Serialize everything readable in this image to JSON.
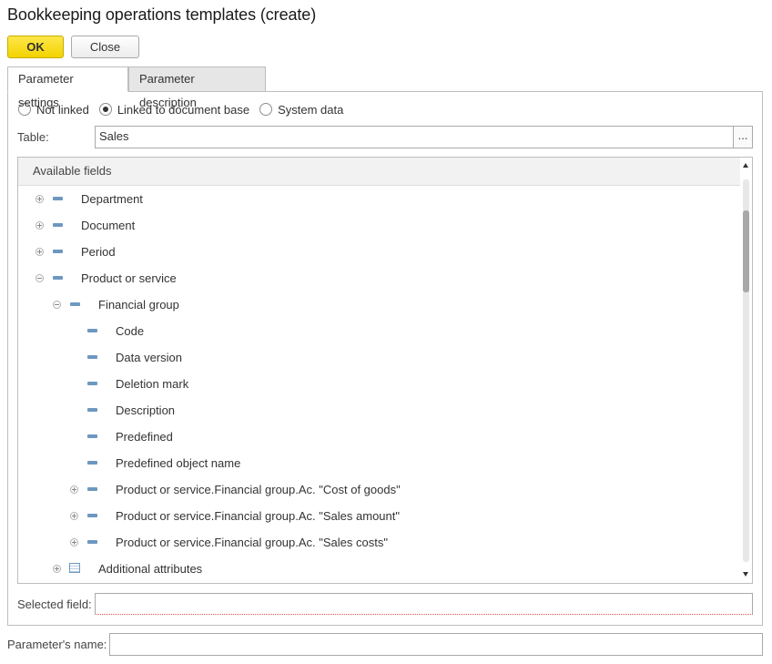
{
  "window": {
    "title": "Bookkeeping operations templates (create)"
  },
  "toolbar": {
    "ok_label": "OK",
    "close_label": "Close"
  },
  "tabs": [
    {
      "label": "Parameter settings",
      "active": true
    },
    {
      "label": "Parameter description",
      "active": false
    }
  ],
  "link_mode": {
    "options": [
      {
        "label": "Not linked",
        "checked": false
      },
      {
        "label": "Linked to document base",
        "checked": true
      },
      {
        "label": "System data",
        "checked": false
      }
    ]
  },
  "table_field": {
    "label": "Table:",
    "value": "Sales",
    "choose_label": "..."
  },
  "fields_tree": {
    "header": "Available fields",
    "rows": [
      {
        "label": "Department",
        "level": 0,
        "expander": "plus",
        "icon": "attribute-icon"
      },
      {
        "label": "Document",
        "level": 0,
        "expander": "plus",
        "icon": "attribute-icon"
      },
      {
        "label": "Period",
        "level": 0,
        "expander": "plus",
        "icon": "attribute-icon"
      },
      {
        "label": "Product or service",
        "level": 0,
        "expander": "minus",
        "icon": "attribute-icon"
      },
      {
        "label": "Financial group",
        "level": 1,
        "expander": "minus",
        "icon": "attribute-icon"
      },
      {
        "label": "Code",
        "level": 2,
        "expander": "none",
        "icon": "attribute-icon"
      },
      {
        "label": "Data version",
        "level": 2,
        "expander": "none",
        "icon": "attribute-icon"
      },
      {
        "label": "Deletion mark",
        "level": 2,
        "expander": "none",
        "icon": "attribute-icon"
      },
      {
        "label": "Description",
        "level": 2,
        "expander": "none",
        "icon": "attribute-icon"
      },
      {
        "label": "Predefined",
        "level": 2,
        "expander": "none",
        "icon": "attribute-icon"
      },
      {
        "label": "Predefined object name",
        "level": 2,
        "expander": "none",
        "icon": "attribute-icon"
      },
      {
        "label": "Product or service.Financial group.Ac. \"Cost of goods\"",
        "level": 2,
        "expander": "plus",
        "icon": "attribute-icon"
      },
      {
        "label": "Product or service.Financial group.Ac. \"Sales amount\"",
        "level": 2,
        "expander": "plus",
        "icon": "attribute-icon"
      },
      {
        "label": "Product or service.Financial group.Ac. \"Sales costs\"",
        "level": 2,
        "expander": "plus",
        "icon": "attribute-icon"
      },
      {
        "label": "Additional attributes",
        "level": 1,
        "expander": "plus",
        "icon": "table-icon"
      }
    ]
  },
  "selected_field": {
    "label": "Selected field:",
    "value": ""
  },
  "parameter_name": {
    "label": "Parameter's name:",
    "value": ""
  }
}
